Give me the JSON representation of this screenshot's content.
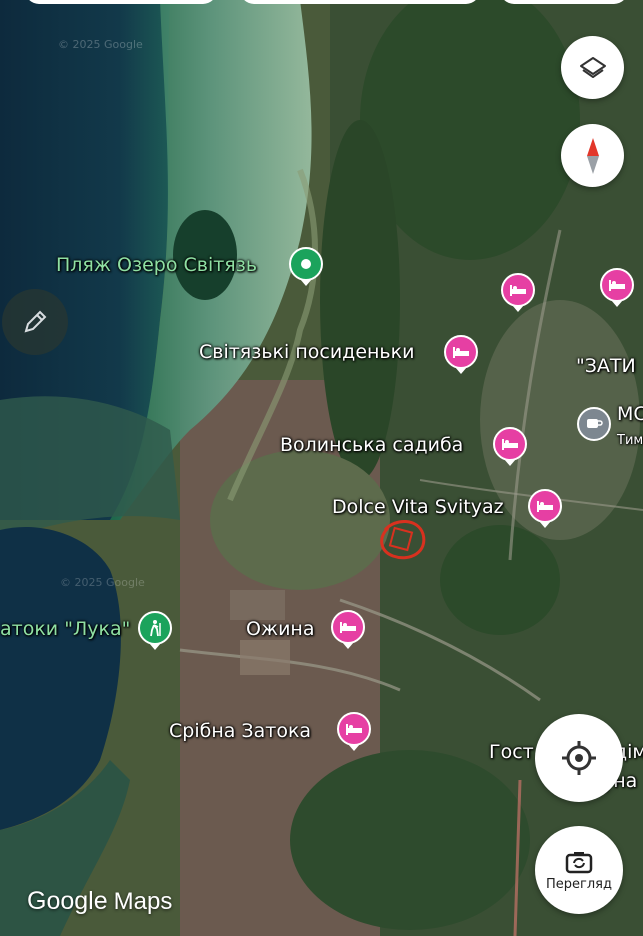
{
  "top_chips": [
    {
      "name": "chip-1"
    },
    {
      "name": "chip-2"
    },
    {
      "name": "chip-3"
    }
  ],
  "map": {
    "places": {
      "beach": "Пляж Озеро Світязь",
      "svityazki": "Світязькі посиденьки",
      "volynska": "Волинська садиба",
      "dolce_vita": "Dolce Vita Svityaz",
      "zatoka_luka": "атоки \"Лука\"",
      "ozhyna": "Ожина",
      "sribna": "Срібна Затока",
      "zaty": "\"ЗАТИ",
      "mo": "МС",
      "tym": "Тим",
      "gost": "Гост",
      "dim": "дім",
      "una": "уна"
    },
    "watermarks": [
      "© 2025 Google",
      "© 2025 Google"
    ],
    "colors": {
      "hotel_pin": "#e63fa3",
      "park_pin": "#1ba35c",
      "cafe_pin": "#7d8790",
      "park_label": "#8fe0a3",
      "annotation": "#d8311f"
    },
    "icons": {
      "layers": "layers-icon",
      "compass": "compass-icon",
      "edit": "pencil-icon",
      "locate": "my-location-icon",
      "streetview": "camera-rotate-icon",
      "hotel": "bed-icon",
      "park": "hiker-icon",
      "cafe": "cup-icon",
      "place": "place-pin-icon"
    }
  },
  "controls": {
    "streetview_label": "Перегляд"
  },
  "branding": {
    "google": "Google",
    "maps": "Maps"
  }
}
